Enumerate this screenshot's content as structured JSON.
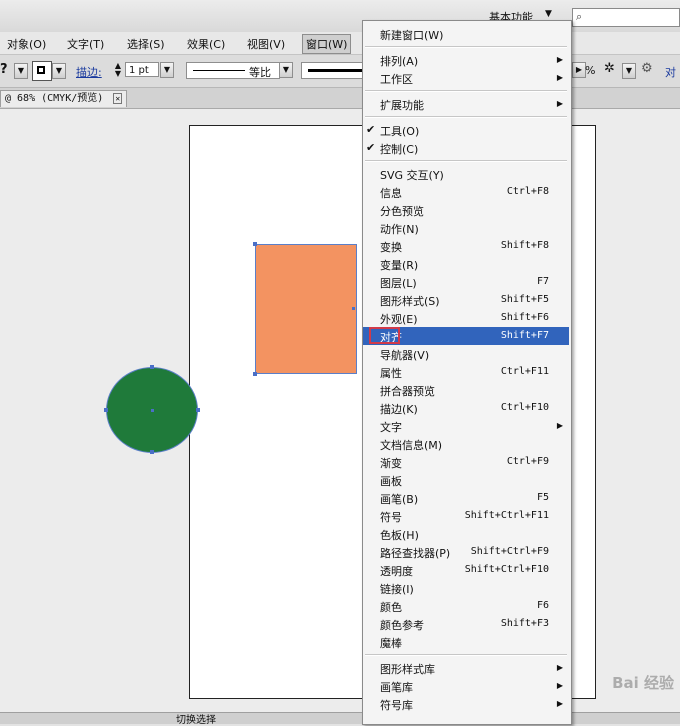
{
  "topbar": {
    "workspace": "基本功能",
    "search_placeholder": ""
  },
  "menubar": {
    "items": [
      "对象(O)",
      "文字(T)",
      "选择(S)",
      "效果(C)",
      "视图(V)",
      "窗口(W)"
    ]
  },
  "controlbar": {
    "stroke_label": "描边:",
    "stroke_weight": "1 pt",
    "profile_label": "等比",
    "opacity_suffix": "%"
  },
  "document_tab": {
    "title": "@ 68% (CMYK/预览)",
    "close": "✕"
  },
  "status": {
    "mode": "切换选择"
  },
  "window_menu": {
    "groups": [
      [
        {
          "label": "新建窗口(W)",
          "shortcut": ""
        }
      ],
      [
        {
          "label": "排列(A)",
          "submenu": true
        },
        {
          "label": "工作区",
          "submenu": true
        }
      ],
      [
        {
          "label": "扩展功能",
          "submenu": true
        }
      ],
      [
        {
          "label": "工具(O)",
          "checked": true
        },
        {
          "label": "控制(C)",
          "checked": true
        }
      ],
      [
        {
          "label": "SVG 交互(Y)"
        },
        {
          "label": "信息",
          "shortcut": "Ctrl+F8"
        },
        {
          "label": "分色预览"
        },
        {
          "label": "动作(N)"
        },
        {
          "label": "变换",
          "shortcut": "Shift+F8"
        },
        {
          "label": "变量(R)"
        },
        {
          "label": "图层(L)",
          "shortcut": "F7"
        },
        {
          "label": "图形样式(S)",
          "shortcut": "Shift+F5"
        },
        {
          "label": "外观(E)",
          "shortcut": "Shift+F6"
        },
        {
          "label": "对齐",
          "shortcut": "Shift+F7",
          "highlighted": true
        },
        {
          "label": "导航器(V)"
        },
        {
          "label": "属性",
          "shortcut": "Ctrl+F11"
        },
        {
          "label": "拼合器预览"
        },
        {
          "label": "描边(K)",
          "shortcut": "Ctrl+F10"
        },
        {
          "label": "文字",
          "submenu": true
        },
        {
          "label": "文档信息(M)"
        },
        {
          "label": "渐变",
          "shortcut": "Ctrl+F9"
        },
        {
          "label": "画板"
        },
        {
          "label": "画笔(B)",
          "shortcut": "F5"
        },
        {
          "label": "符号",
          "shortcut": "Shift+Ctrl+F11"
        },
        {
          "label": "色板(H)"
        },
        {
          "label": "路径查找器(P)",
          "shortcut": "Shift+Ctrl+F9"
        },
        {
          "label": "透明度",
          "shortcut": "Shift+Ctrl+F10"
        },
        {
          "label": "链接(I)"
        },
        {
          "label": "颜色",
          "shortcut": "F6"
        },
        {
          "label": "颜色参考",
          "shortcut": "Shift+F3"
        },
        {
          "label": "魔棒"
        }
      ],
      [
        {
          "label": "图形样式库",
          "submenu": true
        },
        {
          "label": "画笔库",
          "submenu": true
        },
        {
          "label": "符号库",
          "submenu": true
        }
      ]
    ]
  },
  "colors": {
    "rect": "#f39361",
    "circle": "#1f7a3a",
    "highlight": "#3164bc",
    "selection": "#4a6fc7"
  },
  "watermark": "Bai 经验"
}
